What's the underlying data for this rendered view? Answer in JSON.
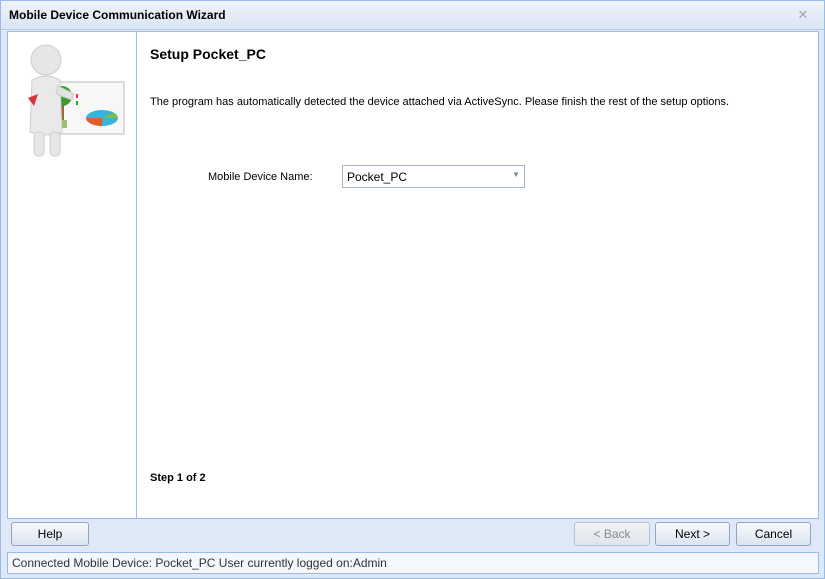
{
  "window": {
    "title": "Mobile Device Communication Wizard"
  },
  "main": {
    "heading": "Setup Pocket_PC",
    "description": "The program has automatically detected the device attached via ActiveSync. Please finish the rest of the setup options.",
    "device_name_label": "Mobile Device Name:",
    "device_name_value": "Pocket_PC",
    "step": "Step 1 of 2"
  },
  "buttons": {
    "help": "Help",
    "back": "< Back",
    "next": "Next >",
    "cancel": "Cancel"
  },
  "status": {
    "text": "Connected Mobile Device: Pocket_PC  User currently logged on:Admin"
  },
  "icons": {
    "close": "close-icon",
    "wizard_illustration": "presenter-figure-icon",
    "dropdown": "chevron-down-icon"
  }
}
